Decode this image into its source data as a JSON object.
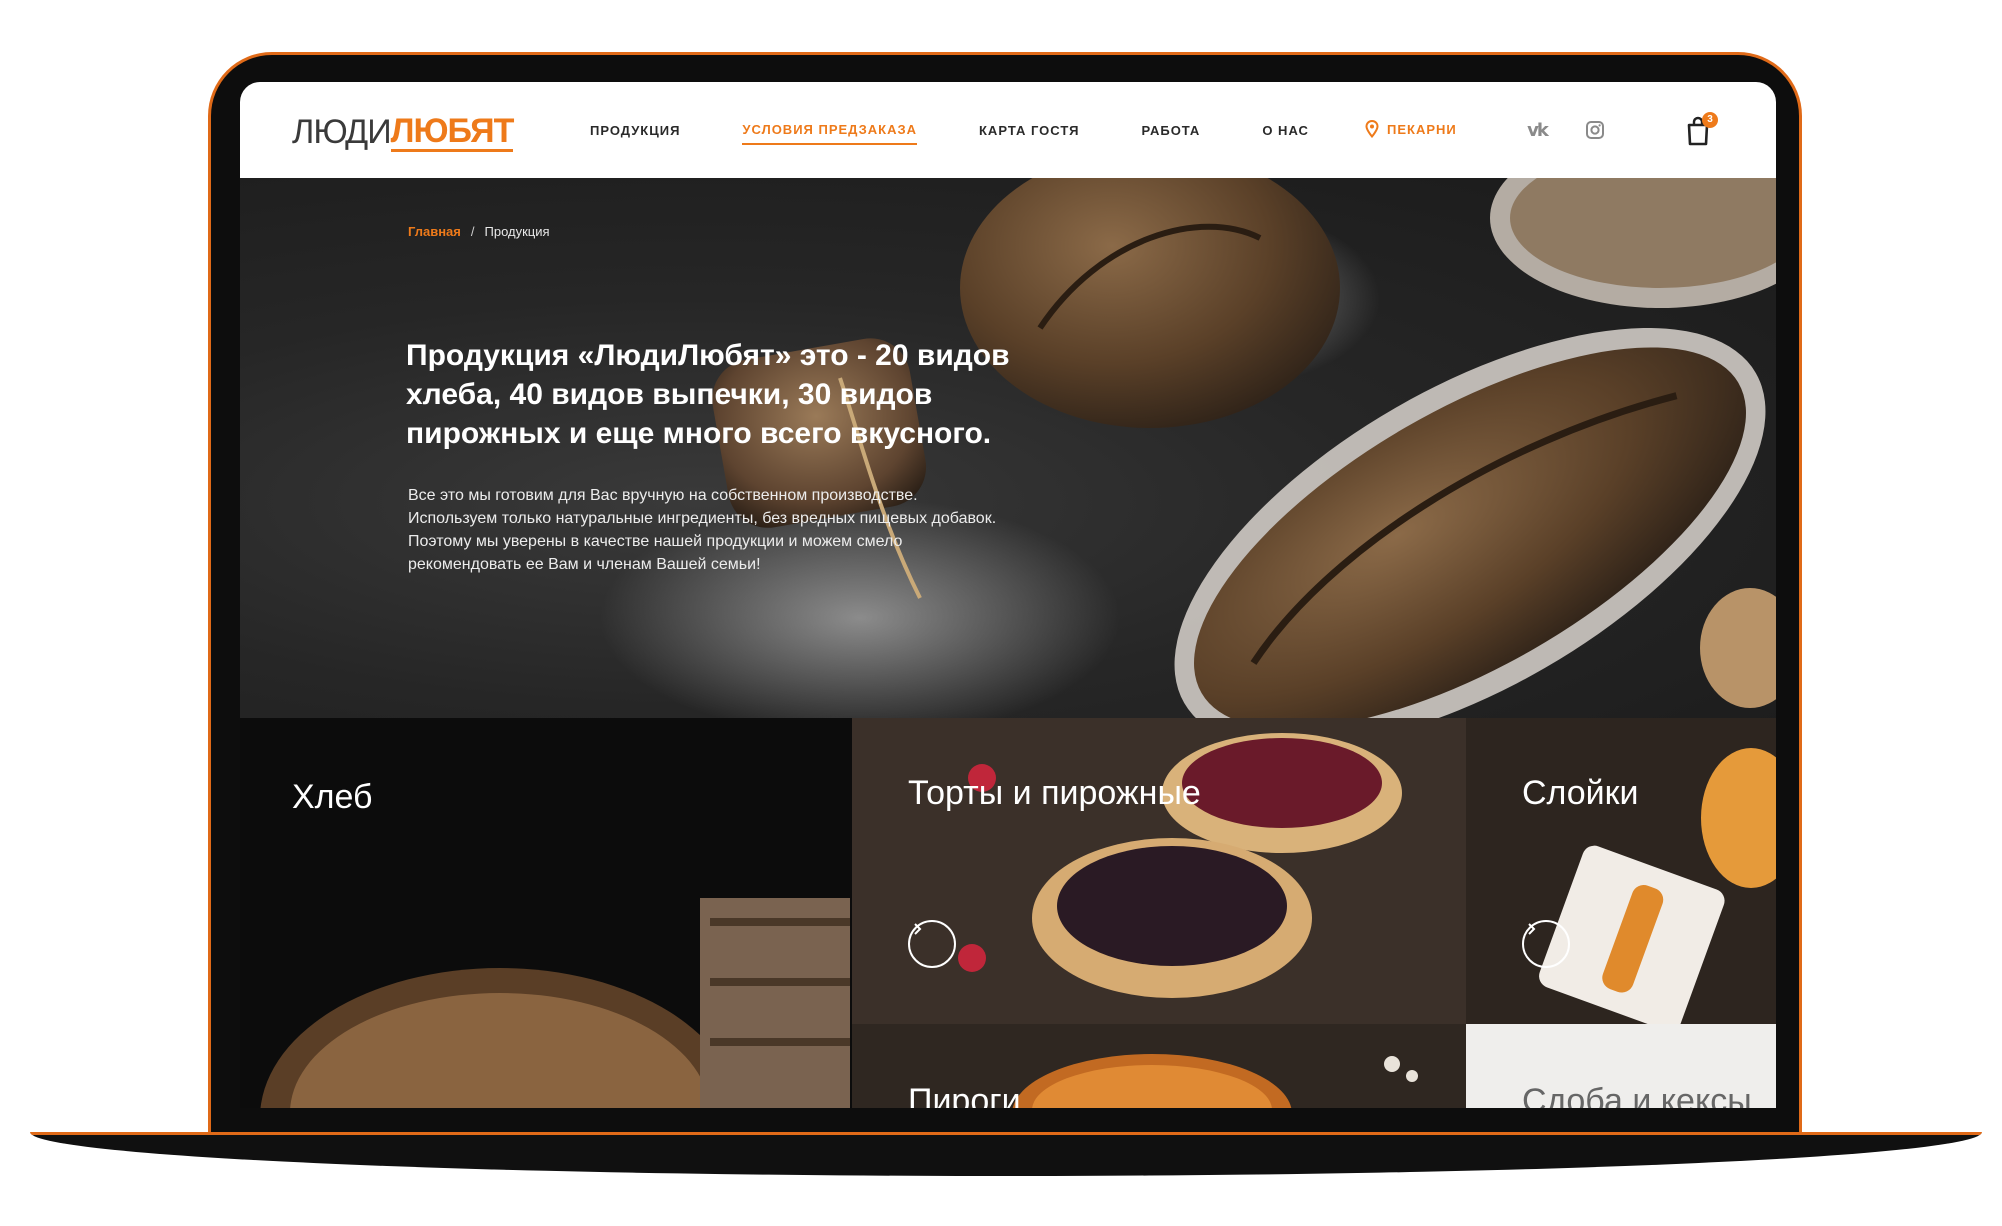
{
  "logo": {
    "part1": "ЛЮДИ",
    "part2": "ЛЮБЯТ"
  },
  "nav": {
    "items": [
      {
        "label": "ПРОДУКЦИЯ",
        "active": false
      },
      {
        "label": "УСЛОВИЯ ПРЕДЗАКАЗА",
        "active": true
      },
      {
        "label": "КАРТА ГОСТЯ",
        "active": false
      },
      {
        "label": "РАБОТА",
        "active": false
      },
      {
        "label": "О НАС",
        "active": false
      }
    ],
    "bakeries": "ПЕКАРНИ",
    "cart_count": "3"
  },
  "breadcrumb": {
    "home": "Главная",
    "separator": "/",
    "current": "Продукция"
  },
  "hero": {
    "title": "Продукция «ЛюдиЛюбят» это - 20 видов хлеба, 40 видов выпечки, 30 видов пирожных и еще много всего вкусного.",
    "text": "Все это мы готовим для Вас вручную на собственном производстве. Используем только натуральные ингредиенты, без вредных пищевых добавок. Поэтому мы уверены в качестве нашей продукции и можем смело рекомендовать ее Вам и членам Вашей семьи!"
  },
  "categories": {
    "bread": "Хлеб",
    "cakes": "Торты и пирожные",
    "puffs": "Слойки",
    "pies": "Пироги",
    "muffins": "Сдоба и кексы"
  },
  "colors": {
    "accent": "#ee7a1a",
    "header_bg": "#ffffff",
    "hero_bg": "#262626"
  },
  "icons": [
    "pin-icon",
    "vk-icon",
    "instagram-icon",
    "cart-icon",
    "arrow-right-icon"
  ]
}
